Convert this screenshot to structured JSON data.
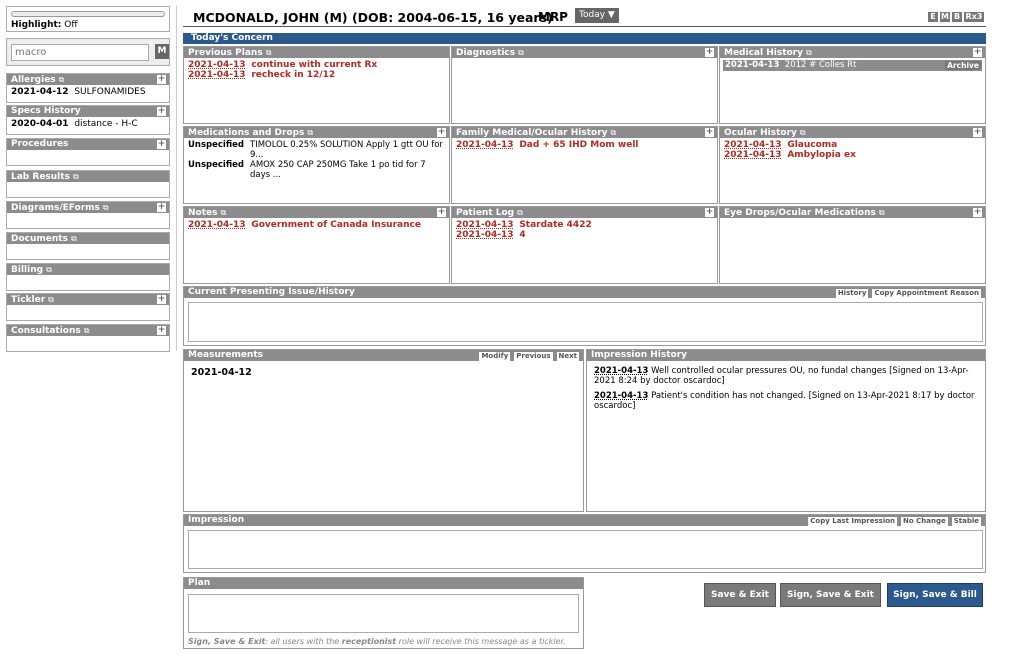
{
  "highlight": {
    "label": "Highlight:",
    "value": "Off"
  },
  "macro": {
    "placeholder": "macro",
    "button": "M"
  },
  "sidebar": {
    "allergies": {
      "title": "Allergies",
      "rows": [
        {
          "date": "2021-04-12",
          "text": "SULFONAMIDES"
        }
      ]
    },
    "specs": {
      "title": "Specs History",
      "rows": [
        {
          "date": "2020-04-01",
          "text": "distance - H-C"
        }
      ]
    },
    "procedures": {
      "title": "Procedures"
    },
    "lab": {
      "title": "Lab Results"
    },
    "diagrams": {
      "title": "Diagrams/EForms"
    },
    "documents": {
      "title": "Documents"
    },
    "billing": {
      "title": "Billing"
    },
    "tickler": {
      "title": "Tickler"
    },
    "consultations": {
      "title": "Consultations"
    }
  },
  "header": {
    "patient": "MCDONALD, JOHN (M) (DOB: 2004-06-15, 16 years)",
    "mrp": "MRP",
    "today": "Today ▼",
    "btn_e": "E",
    "btn_m": "M",
    "btn_b": "B",
    "btn_rx": "Rx3"
  },
  "todays_concern": "Today's Concern",
  "panels": {
    "previous_plans": {
      "title": "Previous Plans",
      "rows": [
        {
          "date": "2021-04-13",
          "text": "continue with current Rx"
        },
        {
          "date": "2021-04-13",
          "text": "recheck in 12/12"
        }
      ]
    },
    "diagnostics": {
      "title": "Diagnostics"
    },
    "medical_history": {
      "title": "Medical History",
      "rows": [
        {
          "date": "2021-04-13",
          "text": "2012 # Colles Rt",
          "action": "Archive"
        }
      ]
    },
    "medications": {
      "title": "Medications and Drops",
      "rows": [
        {
          "label": "Unspecified",
          "text": "TIMOLOL 0.25% SOLUTION Apply 1 gtt OU for 9..."
        },
        {
          "label": "Unspecified",
          "text": "AMOX 250 CAP 250MG Take 1 po tid for 7 days ..."
        }
      ]
    },
    "family_history": {
      "title": "Family Medical/Ocular History",
      "rows": [
        {
          "date": "2021-04-13",
          "text": "Dad + 65 IHD Mom well"
        }
      ]
    },
    "ocular_history": {
      "title": "Ocular History",
      "rows": [
        {
          "date": "2021-04-13",
          "text": "Glaucoma"
        },
        {
          "date": "2021-04-13",
          "text": "Ambylopia ex"
        }
      ]
    },
    "notes": {
      "title": "Notes",
      "rows": [
        {
          "date": "2021-04-13",
          "text": "Government of Canada Insurance"
        }
      ]
    },
    "patient_log": {
      "title": "Patient Log",
      "rows": [
        {
          "date": "2021-04-13",
          "text": "Stardate 4422"
        },
        {
          "date": "2021-04-13",
          "text": "4"
        }
      ]
    },
    "eye_drops": {
      "title": "Eye Drops/Ocular Medications"
    }
  },
  "presenting": {
    "title": "Current Presenting Issue/History",
    "btn_history": "History",
    "btn_copy": "Copy Appointment Reason"
  },
  "measurements": {
    "title": "Measurements",
    "btn_modify": "Modify",
    "btn_previous": "Previous",
    "btn_next": "Next",
    "date": "2021-04-12"
  },
  "impression_history": {
    "title": "Impression History",
    "entries": [
      {
        "date": "2021-04-13",
        "text": "Well controlled ocular pressures OU, no fundal changes [Signed on 13-Apr-2021 8:24 by doctor oscardoc]"
      },
      {
        "date": "2021-04-13",
        "text": "Patient's condition has not changed. [Signed on 13-Apr-2021 8:17 by doctor oscardoc]"
      }
    ]
  },
  "impression": {
    "title": "Impression",
    "btn_copy": "Copy Last Impression",
    "btn_nochange": "No Change",
    "btn_stable": "Stable"
  },
  "plan": {
    "title": "Plan",
    "note_bold": "Sign, Save & Exit",
    "note_mid": ": all users with the ",
    "note_role": "receptionist",
    "note_end": " role will receive this message as a tickler."
  },
  "actions": {
    "save_exit": "Save & Exit",
    "sign_save_exit": "Sign, Save & Exit",
    "sign_save_bill": "Sign, Save & Bill"
  },
  "colors": {
    "header_blue": "#2d5a8c",
    "bar_gray": "#8c8c8c",
    "date_red": "#b02a22",
    "bill_blue": "#2d5a8c"
  }
}
